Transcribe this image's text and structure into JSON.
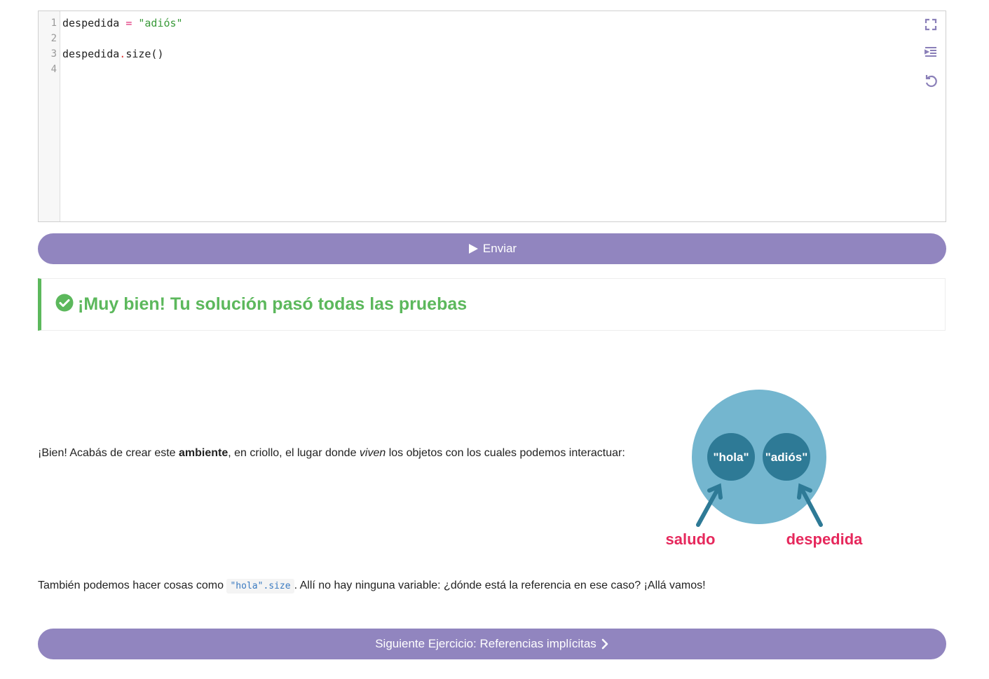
{
  "editor": {
    "line_numbers": [
      "1",
      "2",
      "3",
      "4"
    ],
    "lines": [
      {
        "var": "despedida",
        "op": "=",
        "str": "\"adiós\""
      },
      {
        "obj": "despedida",
        "dot": ".",
        "call": "size()"
      }
    ],
    "tools": [
      "fullscreen-icon",
      "indent-icon",
      "reset-icon"
    ]
  },
  "submit_button": {
    "label": "Enviar",
    "icon": "play-icon"
  },
  "result": {
    "icon": "check-circle-icon",
    "message": "¡Muy bien! Tu solución pasó todas las pruebas",
    "color": "#5cb85c"
  },
  "explanation": {
    "p1_a": "¡Bien! Acabás de crear este ",
    "p1_bold": "ambiente",
    "p1_b": ", en criollo, el lugar donde ",
    "p1_italic": "viven",
    "p1_c": " los objetos con los cuales podemos interactuar:",
    "p2_a": "También podemos hacer cosas como ",
    "p2_code_str": "\"hola\"",
    "p2_code_rest": ".size",
    "p2_b": ". Allí no hay ninguna variable: ¿dónde está la referencia en ese caso? ¡Allá vamos!"
  },
  "diagram": {
    "objects": [
      "\"hola\"",
      "\"adiós\""
    ],
    "references": [
      "saludo",
      "despedida"
    ],
    "colors": {
      "environment": "#74b6cf",
      "object": "#2e7a96",
      "reference": "#e6285c"
    }
  },
  "next_button": {
    "label": "Siguiente Ejercicio: Referencias implícitas",
    "icon": "chevron-right-icon"
  },
  "colors": {
    "accent": "#9185bf"
  }
}
